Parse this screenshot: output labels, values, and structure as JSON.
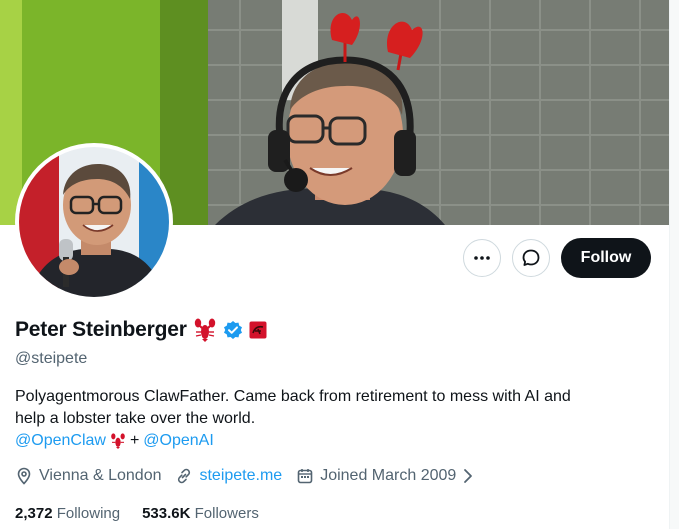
{
  "profile": {
    "name": "Peter Steinberger",
    "name_emoji": "🦞",
    "handle": "@steipete",
    "bio_line1": "Polyagentmorous ClawFather. Came back from retirement to mess with AI and",
    "bio_line2": "help a lobster take over the world.",
    "mention1": "@OpenClaw",
    "mention1_emoji": "🦞",
    "mention_joiner": "+",
    "mention2": "@OpenAI",
    "location": "Vienna & London",
    "website": "steipete.me",
    "joined": "Joined March 2009",
    "following_count": "2,372",
    "following_label": "Following",
    "followers_count": "533.6K",
    "followers_label": "Followers"
  },
  "actions": {
    "more_icon": "more-horizontal-icon",
    "message_icon": "message-bubble-icon",
    "follow_label": "Follow"
  },
  "badges": {
    "verified_icon": "verified-badge-icon",
    "affiliate_icon": "affiliate-badge-icon"
  },
  "colors": {
    "accent": "#1d9bf0",
    "text_primary": "#0f1419",
    "text_secondary": "#536471",
    "follow_bg": "#0f1419",
    "lobster_red": "#d3122b"
  }
}
